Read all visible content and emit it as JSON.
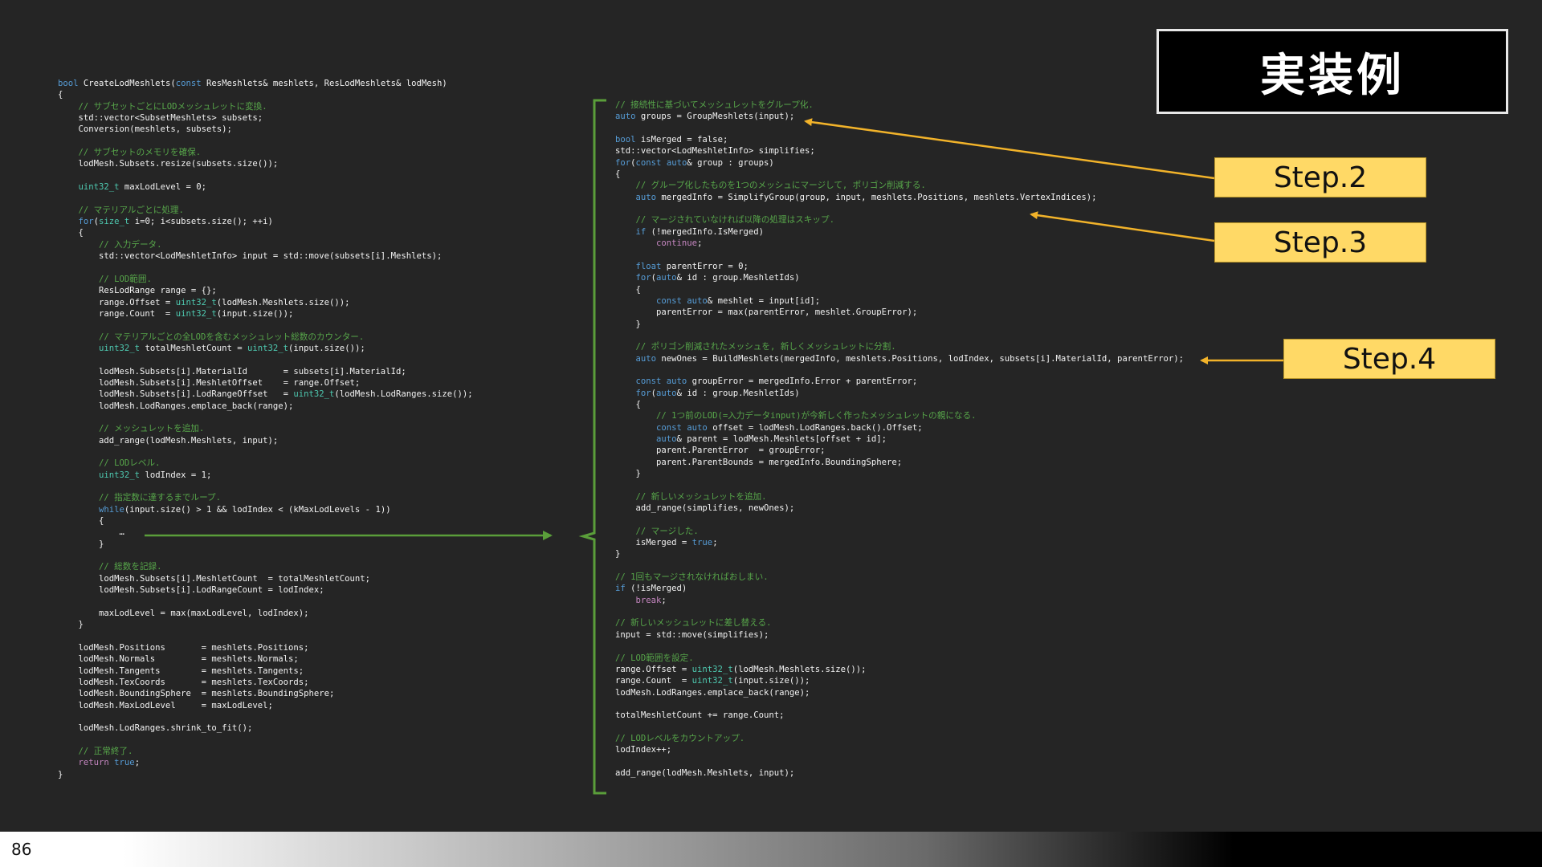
{
  "slide": {
    "title": "実装例",
    "page_number": "86",
    "steps": [
      {
        "label": "Step.2"
      },
      {
        "label": "Step.3"
      },
      {
        "label": "Step.4"
      }
    ],
    "colors": {
      "background": "#252525",
      "accent_step": "#ffd966",
      "arrow": "#f2b32a",
      "bracket": "#5a9e3a"
    }
  },
  "left_code": [
    [
      [
        "kw",
        "bool"
      ],
      [
        "t",
        " CreateLodMeshlets("
      ],
      [
        "kw",
        "const"
      ],
      [
        "t",
        " ResMeshlets& meshlets, ResLodMeshlets& lodMesh)"
      ]
    ],
    [
      [
        "t",
        "{"
      ]
    ],
    [
      [
        "cm",
        "    // サブセットごとにLODメッシュレットに変換."
      ]
    ],
    [
      [
        "t",
        "    std::vector<SubsetMeshlets> subsets;"
      ]
    ],
    [
      [
        "t",
        "    Conversion(meshlets, subsets);"
      ]
    ],
    [],
    [
      [
        "cm",
        "    // サブセットのメモリを確保."
      ]
    ],
    [
      [
        "t",
        "    lodMesh.Subsets.resize(subsets.size());"
      ]
    ],
    [],
    [
      [
        "ty",
        "    uint32_t"
      ],
      [
        "t",
        " maxLodLevel = 0;"
      ]
    ],
    [],
    [
      [
        "cm",
        "    // マテリアルごとに処理."
      ]
    ],
    [
      [
        "kw",
        "    for"
      ],
      [
        "t",
        "("
      ],
      [
        "ty",
        "size_t"
      ],
      [
        "t",
        " i=0; i<subsets.size(); ++i)"
      ]
    ],
    [
      [
        "t",
        "    {"
      ]
    ],
    [
      [
        "cm",
        "        // 入力データ."
      ]
    ],
    [
      [
        "t",
        "        std::vector<LodMeshletInfo> input = std::move(subsets[i].Meshlets);"
      ]
    ],
    [],
    [
      [
        "cm",
        "        // LOD範囲."
      ]
    ],
    [
      [
        "t",
        "        ResLodRange range = {};"
      ]
    ],
    [
      [
        "t",
        "        range.Offset = "
      ],
      [
        "ty",
        "uint32_t"
      ],
      [
        "t",
        "(lodMesh.Meshlets.size());"
      ]
    ],
    [
      [
        "t",
        "        range.Count  = "
      ],
      [
        "ty",
        "uint32_t"
      ],
      [
        "t",
        "(input.size());"
      ]
    ],
    [],
    [
      [
        "cm",
        "        // マテリアルごとの全LODを含むメッシュレット総数のカウンター."
      ]
    ],
    [
      [
        "ty",
        "        uint32_t"
      ],
      [
        "t",
        " totalMeshletCount = "
      ],
      [
        "ty",
        "uint32_t"
      ],
      [
        "t",
        "(input.size());"
      ]
    ],
    [],
    [
      [
        "t",
        "        lodMesh.Subsets[i].MaterialId       = subsets[i].MaterialId;"
      ]
    ],
    [
      [
        "t",
        "        lodMesh.Subsets[i].MeshletOffset    = range.Offset;"
      ]
    ],
    [
      [
        "t",
        "        lodMesh.Subsets[i].LodRangeOffset   = "
      ],
      [
        "ty",
        "uint32_t"
      ],
      [
        "t",
        "(lodMesh.LodRanges.size());"
      ]
    ],
    [
      [
        "t",
        "        lodMesh.LodRanges.emplace_back(range);"
      ]
    ],
    [],
    [
      [
        "cm",
        "        // メッシュレットを追加."
      ]
    ],
    [
      [
        "t",
        "        add_range(lodMesh.Meshlets, input);"
      ]
    ],
    [],
    [
      [
        "cm",
        "        // LODレベル."
      ]
    ],
    [
      [
        "ty",
        "        uint32_t"
      ],
      [
        "t",
        " lodIndex = 1;"
      ]
    ],
    [],
    [
      [
        "cm",
        "        // 指定数に達するまでループ."
      ]
    ],
    [
      [
        "kw",
        "        while"
      ],
      [
        "t",
        "(input.size() > 1 && lodIndex < (kMaxLodLevels - 1))"
      ]
    ],
    [
      [
        "t",
        "        {"
      ]
    ],
    [
      [
        "t",
        "            …"
      ]
    ],
    [
      [
        "t",
        "        }"
      ]
    ],
    [],
    [
      [
        "cm",
        "        // 総数を記録."
      ]
    ],
    [
      [
        "t",
        "        lodMesh.Subsets[i].MeshletCount  = totalMeshletCount;"
      ]
    ],
    [
      [
        "t",
        "        lodMesh.Subsets[i].LodRangeCount = lodIndex;"
      ]
    ],
    [],
    [
      [
        "t",
        "        maxLodLevel = max(maxLodLevel, lodIndex);"
      ]
    ],
    [
      [
        "t",
        "    }"
      ]
    ],
    [],
    [
      [
        "t",
        "    lodMesh.Positions       = meshlets.Positions;"
      ]
    ],
    [
      [
        "t",
        "    lodMesh.Normals         = meshlets.Normals;"
      ]
    ],
    [
      [
        "t",
        "    lodMesh.Tangents        = meshlets.Tangents;"
      ]
    ],
    [
      [
        "t",
        "    lodMesh.TexCoords       = meshlets.TexCoords;"
      ]
    ],
    [
      [
        "t",
        "    lodMesh.BoundingSphere  = meshlets.BoundingSphere;"
      ]
    ],
    [
      [
        "t",
        "    lodMesh.MaxLodLevel     = maxLodLevel;"
      ]
    ],
    [],
    [
      [
        "t",
        "    lodMesh.LodRanges.shrink_to_fit();"
      ]
    ],
    [],
    [
      [
        "cm",
        "    // 正常終了."
      ]
    ],
    [
      [
        "ctl",
        "    return"
      ],
      [
        "t",
        " "
      ],
      [
        "kw",
        "true"
      ],
      [
        "t",
        ";"
      ]
    ],
    [
      [
        "t",
        "}"
      ]
    ]
  ],
  "right_code": [
    [
      [
        "cm",
        "// 接続性に基づいてメッシュレットをグループ化."
      ]
    ],
    [
      [
        "kw",
        "auto"
      ],
      [
        "t",
        " groups = GroupMeshlets(input);"
      ]
    ],
    [],
    [
      [
        "kw",
        "bool"
      ],
      [
        "t",
        " isMerged = false;"
      ]
    ],
    [
      [
        "t",
        "std::vector<LodMeshletInfo> simplifies;"
      ]
    ],
    [
      [
        "kw",
        "for"
      ],
      [
        "t",
        "("
      ],
      [
        "kw",
        "const"
      ],
      [
        "t",
        " "
      ],
      [
        "kw",
        "auto"
      ],
      [
        "t",
        "& group : groups)"
      ]
    ],
    [
      [
        "t",
        "{"
      ]
    ],
    [
      [
        "cm",
        "    // グループ化したものを1つのメッシュにマージして, ポリゴン削減する."
      ]
    ],
    [
      [
        "kw",
        "    auto"
      ],
      [
        "t",
        " mergedInfo = SimplifyGroup(group, input, meshlets.Positions, meshlets.VertexIndices);"
      ]
    ],
    [],
    [
      [
        "cm",
        "    // マージされていなければ以降の処理はスキップ."
      ]
    ],
    [
      [
        "kw",
        "    if"
      ],
      [
        "t",
        " (!mergedInfo.IsMerged)"
      ]
    ],
    [
      [
        "ctl",
        "        continue"
      ],
      [
        "t",
        ";"
      ]
    ],
    [],
    [
      [
        "kw",
        "    float"
      ],
      [
        "t",
        " parentError = 0;"
      ]
    ],
    [
      [
        "kw",
        "    for"
      ],
      [
        "t",
        "("
      ],
      [
        "kw",
        "auto"
      ],
      [
        "t",
        "& id : group.MeshletIds)"
      ]
    ],
    [
      [
        "t",
        "    {"
      ]
    ],
    [
      [
        "kw",
        "        const auto"
      ],
      [
        "t",
        "& meshlet = input[id];"
      ]
    ],
    [
      [
        "t",
        "        parentError = max(parentError, meshlet.GroupError);"
      ]
    ],
    [
      [
        "t",
        "    }"
      ]
    ],
    [],
    [
      [
        "cm",
        "    // ポリゴン削減されたメッシュを, 新しくメッシュレットに分割."
      ]
    ],
    [
      [
        "kw",
        "    auto"
      ],
      [
        "t",
        " newOnes = BuildMeshlets(mergedInfo, meshlets.Positions, lodIndex, subsets[i].MaterialId, parentError);"
      ]
    ],
    [],
    [
      [
        "kw",
        "    const auto"
      ],
      [
        "t",
        " groupError = mergedInfo.Error + parentError;"
      ]
    ],
    [
      [
        "kw",
        "    for"
      ],
      [
        "t",
        "("
      ],
      [
        "kw",
        "auto"
      ],
      [
        "t",
        "& id : group.MeshletIds)"
      ]
    ],
    [
      [
        "t",
        "    {"
      ]
    ],
    [
      [
        "cm",
        "        // 1つ前のLOD(=入力データinput)が今新しく作ったメッシュレットの親になる."
      ]
    ],
    [
      [
        "kw",
        "        const auto"
      ],
      [
        "t",
        " offset = lodMesh.LodRanges.back().Offset;"
      ]
    ],
    [
      [
        "kw",
        "        auto"
      ],
      [
        "t",
        "& parent = lodMesh.Meshlets[offset + id];"
      ]
    ],
    [
      [
        "t",
        "        parent.ParentError  = groupError;"
      ]
    ],
    [
      [
        "t",
        "        parent.ParentBounds = mergedInfo.BoundingSphere;"
      ]
    ],
    [
      [
        "t",
        "    }"
      ]
    ],
    [],
    [
      [
        "cm",
        "    // 新しいメッシュレットを追加."
      ]
    ],
    [
      [
        "t",
        "    add_range(simplifies, newOnes);"
      ]
    ],
    [],
    [
      [
        "cm",
        "    // マージした."
      ]
    ],
    [
      [
        "t",
        "    isMerged = "
      ],
      [
        "kw",
        "true"
      ],
      [
        "t",
        ";"
      ]
    ],
    [
      [
        "t",
        "}"
      ]
    ],
    [],
    [
      [
        "cm",
        "// 1回もマージされなければおしまい."
      ]
    ],
    [
      [
        "kw",
        "if"
      ],
      [
        "t",
        " (!isMerged)"
      ]
    ],
    [
      [
        "ctl",
        "    break"
      ],
      [
        "t",
        ";"
      ]
    ],
    [],
    [
      [
        "cm",
        "// 新しいメッシュレットに差し替える."
      ]
    ],
    [
      [
        "t",
        "input = std::move(simplifies);"
      ]
    ],
    [],
    [
      [
        "cm",
        "// LOD範囲を設定."
      ]
    ],
    [
      [
        "t",
        "range.Offset = "
      ],
      [
        "ty",
        "uint32_t"
      ],
      [
        "t",
        "(lodMesh.Meshlets.size());"
      ]
    ],
    [
      [
        "t",
        "range.Count  = "
      ],
      [
        "ty",
        "uint32_t"
      ],
      [
        "t",
        "(input.size());"
      ]
    ],
    [
      [
        "t",
        "lodMesh.LodRanges.emplace_back(range);"
      ]
    ],
    [],
    [
      [
        "t",
        "totalMeshletCount += range.Count;"
      ]
    ],
    [],
    [
      [
        "cm",
        "// LODレベルをカウントアップ."
      ]
    ],
    [
      [
        "t",
        "lodIndex++;"
      ]
    ],
    [],
    [
      [
        "t",
        "add_range(lodMesh.Meshlets, input);"
      ]
    ]
  ]
}
